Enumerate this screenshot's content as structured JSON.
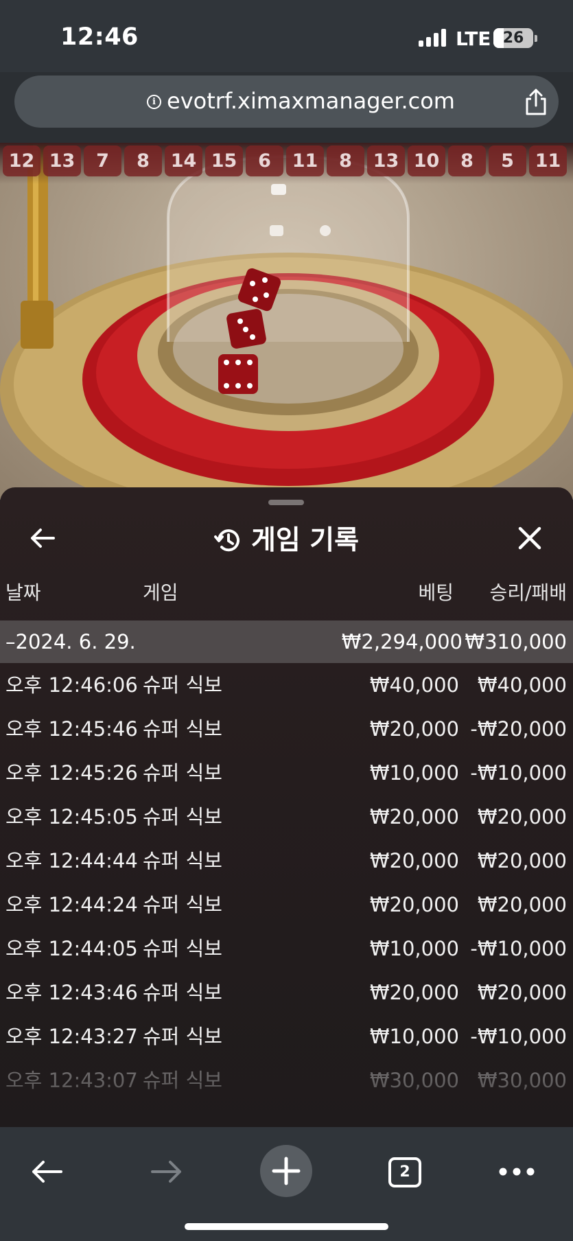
{
  "status_bar": {
    "time": "12:46",
    "network": "LTE",
    "battery": "26",
    "battery_level": 0.26
  },
  "browser": {
    "url": "evotrf.ximaxmanager.com",
    "open_tabs": "2"
  },
  "game_results": [
    "12",
    "13",
    "7",
    "8",
    "14",
    "15",
    "6",
    "11",
    "8",
    "13",
    "10",
    "8",
    "5",
    "11"
  ],
  "history_panel": {
    "title": "게임 기록",
    "columns": {
      "date": "날짜",
      "game": "게임",
      "bet": "베팅",
      "win_loss": "승리/패배"
    },
    "date_group": {
      "date": "–2024. 6. 29.",
      "bet_total": "₩2,294,000",
      "win_loss_total": "₩310,000"
    },
    "rows": [
      {
        "time": "오후 12:46:06",
        "game": "슈퍼 식보",
        "bet": "₩40,000",
        "result": "₩40,000"
      },
      {
        "time": "오후 12:45:46",
        "game": "슈퍼 식보",
        "bet": "₩20,000",
        "result": "-₩20,000"
      },
      {
        "time": "오후 12:45:26",
        "game": "슈퍼 식보",
        "bet": "₩10,000",
        "result": "-₩10,000"
      },
      {
        "time": "오후 12:45:05",
        "game": "슈퍼 식보",
        "bet": "₩20,000",
        "result": "₩20,000"
      },
      {
        "time": "오후 12:44:44",
        "game": "슈퍼 식보",
        "bet": "₩20,000",
        "result": "₩20,000"
      },
      {
        "time": "오후 12:44:24",
        "game": "슈퍼 식보",
        "bet": "₩20,000",
        "result": "₩20,000"
      },
      {
        "time": "오후 12:44:05",
        "game": "슈퍼 식보",
        "bet": "₩10,000",
        "result": "-₩10,000"
      },
      {
        "time": "오후 12:43:46",
        "game": "슈퍼 식보",
        "bet": "₩20,000",
        "result": "₩20,000"
      },
      {
        "time": "오후 12:43:27",
        "game": "슈퍼 식보",
        "bet": "₩10,000",
        "result": "-₩10,000"
      },
      {
        "time": "오후 12:43:07",
        "game": "슈퍼 식보",
        "bet": "₩30,000",
        "result": "₩30,000"
      }
    ]
  },
  "icons": {
    "info": "info-icon",
    "share": "share-icon",
    "back": "arrow-left-icon",
    "history": "history-icon",
    "close": "close-icon",
    "forward": "arrow-right-icon",
    "new_tab": "plus-icon",
    "tabs": "tabs-icon",
    "more": "more-icon"
  }
}
